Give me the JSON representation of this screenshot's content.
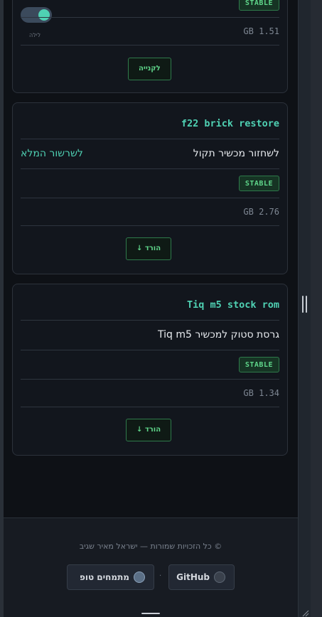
{
  "card1": {
    "badge": "STABLE",
    "toggle_label": "לילה",
    "size": "GB 1.51",
    "button": "לקנייה"
  },
  "card2": {
    "title": "f22 brick restore",
    "description": "לשחזור מכשיר תקול",
    "link": "לשרשור המלא",
    "badge": "STABLE",
    "size": "GB 2.76",
    "button": "הורד ↓"
  },
  "card3": {
    "title": "Tiq m5 stock rom",
    "description": "גרסת סטוק למכשיר Tiq m5",
    "badge": "STABLE",
    "size": "GB 1.34",
    "button": "הורד ↓"
  },
  "footer": {
    "copyright": "© כל הזכויות שמורות — ישראל מאיר שגיב",
    "github": "GitHub",
    "separator": "·",
    "community": "מתמחים טופ"
  },
  "colors": {
    "accent": "#4fd1b3",
    "badge_green": "#5fd68a",
    "background": "#0e1116"
  }
}
